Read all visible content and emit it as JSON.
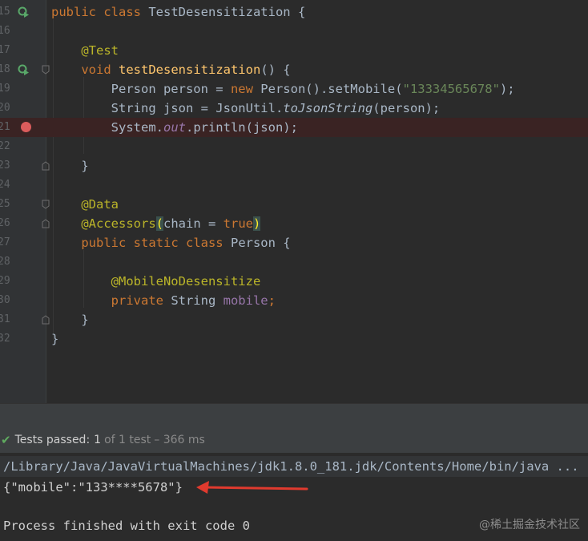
{
  "editor": {
    "lines": [
      {
        "num": "15",
        "segments": [
          [
            "kw",
            "public "
          ],
          [
            "kw",
            "class "
          ],
          [
            "plain",
            "TestDesensitization {"
          ]
        ]
      },
      {
        "num": "16",
        "segments": []
      },
      {
        "num": "17",
        "segments": [
          [
            "plain",
            "    "
          ],
          [
            "ann",
            "@Test"
          ]
        ]
      },
      {
        "num": "18",
        "segments": [
          [
            "plain",
            "    "
          ],
          [
            "kw",
            "void "
          ],
          [
            "fn",
            "testDesensitization"
          ],
          [
            "plain",
            "() {"
          ]
        ]
      },
      {
        "num": "19",
        "segments": [
          [
            "plain",
            "        Person person = "
          ],
          [
            "kw",
            "new "
          ],
          [
            "plain",
            "Person().setMobile("
          ],
          [
            "str",
            "\"13334565678\""
          ],
          [
            "plain",
            ");"
          ]
        ]
      },
      {
        "num": "20",
        "segments": [
          [
            "plain",
            "        String json = JsonUtil."
          ],
          [
            "ital",
            "toJsonString"
          ],
          [
            "plain",
            "(person);"
          ]
        ]
      },
      {
        "num": "21",
        "segments": [
          [
            "plain",
            "        System."
          ],
          [
            "field-it",
            "out"
          ],
          [
            "plain",
            ".println(json);"
          ]
        ]
      },
      {
        "num": "22",
        "segments": []
      },
      {
        "num": "23",
        "segments": [
          [
            "plain",
            "    }"
          ]
        ]
      },
      {
        "num": "24",
        "segments": []
      },
      {
        "num": "25",
        "segments": [
          [
            "plain",
            "    "
          ],
          [
            "ann",
            "@Data"
          ]
        ]
      },
      {
        "num": "26",
        "segments": [
          [
            "plain",
            "    "
          ],
          [
            "ann",
            "@Accessors"
          ],
          [
            "paren-hl",
            "("
          ],
          [
            "plain",
            "chain = "
          ],
          [
            "kw",
            "true"
          ],
          [
            "paren-hl",
            ")"
          ]
        ]
      },
      {
        "num": "27",
        "segments": [
          [
            "plain",
            "    "
          ],
          [
            "kw",
            "public "
          ],
          [
            "kw",
            "static "
          ],
          [
            "kw",
            "class "
          ],
          [
            "plain",
            "Person {"
          ]
        ]
      },
      {
        "num": "28",
        "segments": []
      },
      {
        "num": "29",
        "segments": [
          [
            "plain",
            "        "
          ],
          [
            "ann",
            "@MobileNoDesensitize"
          ]
        ]
      },
      {
        "num": "30",
        "segments": [
          [
            "plain",
            "        "
          ],
          [
            "kw",
            "private "
          ],
          [
            "plain",
            "String "
          ],
          [
            "fld",
            "mobile"
          ],
          [
            "kw",
            ";"
          ]
        ]
      },
      {
        "num": "31",
        "segments": [
          [
            "plain",
            "    }"
          ]
        ]
      },
      {
        "num": "32",
        "segments": [
          [
            "plain",
            "}"
          ]
        ]
      }
    ]
  },
  "test_status": {
    "label": "Tests passed:",
    "passed_count": "1",
    "of_total": "of 1 test",
    "duration": "– 366 ms"
  },
  "console": {
    "java_path": "/Library/Java/JavaVirtualMachines/jdk1.8.0_181.jdk/Contents/Home/bin/java ...",
    "output": "{\"mobile\":\"133****5678\"}",
    "exit_message": "Process finished with exit code 0"
  },
  "watermark": "@稀土掘金技术社区",
  "colors": {
    "keyword": "#cc7832",
    "annotation": "#bbb529",
    "method": "#ffc66d",
    "string": "#6a8759",
    "field": "#9876aa",
    "breakpoint": "#db5c5c",
    "arrow": "#e03a2e"
  }
}
